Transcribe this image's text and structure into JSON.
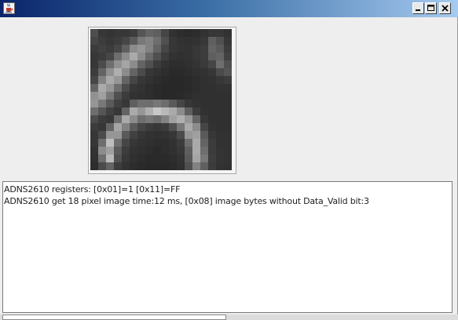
{
  "window": {
    "title": "",
    "icon": "java-cup-icon",
    "controls": {
      "minimize_icon": "minimize-icon",
      "maximize_icon": "maximize-icon",
      "close_icon": "close-icon"
    }
  },
  "console": {
    "lines": [
      "ADNS2610 registers: [0x01]=1 [0x11]=FF",
      "ADNS2610 get 18 pixel image time:12 ms, [0x08] image bytes without Data_Valid bit:3"
    ]
  },
  "sensor_image": {
    "width": 18,
    "height": 18,
    "pixels": [
      [
        78,
        55,
        52,
        55,
        55,
        60,
        85,
        100,
        95,
        70,
        50,
        45,
        42,
        45,
        50,
        55,
        55,
        50
      ],
      [
        70,
        60,
        55,
        60,
        70,
        90,
        120,
        130,
        110,
        80,
        55,
        50,
        48,
        50,
        55,
        95,
        80,
        55
      ],
      [
        60,
        65,
        60,
        70,
        95,
        140,
        150,
        130,
        100,
        70,
        55,
        52,
        50,
        55,
        60,
        100,
        90,
        60
      ],
      [
        55,
        60,
        70,
        110,
        140,
        170,
        140,
        105,
        80,
        60,
        50,
        48,
        50,
        55,
        60,
        95,
        100,
        65
      ],
      [
        55,
        75,
        110,
        145,
        165,
        140,
        100,
        80,
        60,
        50,
        45,
        45,
        48,
        52,
        58,
        70,
        110,
        80
      ],
      [
        60,
        100,
        145,
        175,
        140,
        100,
        75,
        55,
        50,
        45,
        42,
        42,
        45,
        48,
        50,
        55,
        75,
        85
      ],
      [
        70,
        130,
        170,
        150,
        100,
        70,
        55,
        50,
        45,
        42,
        40,
        40,
        42,
        45,
        48,
        50,
        55,
        60
      ],
      [
        100,
        170,
        150,
        110,
        75,
        55,
        50,
        45,
        42,
        40,
        40,
        40,
        42,
        45,
        48,
        48,
        50,
        50
      ],
      [
        145,
        160,
        120,
        80,
        60,
        50,
        48,
        45,
        42,
        40,
        40,
        42,
        45,
        48,
        48,
        48,
        48,
        48
      ],
      [
        150,
        120,
        90,
        65,
        55,
        95,
        110,
        110,
        120,
        110,
        90,
        70,
        55,
        50,
        48,
        48,
        48,
        48
      ],
      [
        110,
        85,
        65,
        55,
        100,
        170,
        150,
        175,
        200,
        185,
        170,
        140,
        95,
        60,
        50,
        48,
        48,
        48
      ],
      [
        75,
        60,
        55,
        110,
        170,
        140,
        110,
        120,
        110,
        130,
        160,
        175,
        150,
        100,
        55,
        48,
        48,
        48
      ],
      [
        60,
        55,
        100,
        165,
        130,
        90,
        70,
        60,
        55,
        60,
        80,
        120,
        170,
        140,
        70,
        50,
        48,
        48
      ],
      [
        55,
        75,
        150,
        150,
        90,
        65,
        55,
        50,
        48,
        50,
        55,
        75,
        150,
        160,
        90,
        55,
        50,
        50
      ],
      [
        55,
        110,
        190,
        110,
        70,
        55,
        50,
        48,
        45,
        45,
        50,
        60,
        110,
        170,
        100,
        60,
        50,
        50
      ],
      [
        50,
        140,
        160,
        90,
        60,
        50,
        48,
        45,
        42,
        45,
        48,
        55,
        95,
        170,
        110,
        60,
        52,
        50
      ],
      [
        48,
        110,
        185,
        80,
        55,
        48,
        45,
        42,
        42,
        42,
        45,
        50,
        90,
        165,
        120,
        62,
        52,
        50
      ],
      [
        45,
        75,
        100,
        60,
        50,
        45,
        42,
        40,
        40,
        40,
        42,
        48,
        80,
        130,
        95,
        60,
        50,
        48
      ]
    ]
  }
}
